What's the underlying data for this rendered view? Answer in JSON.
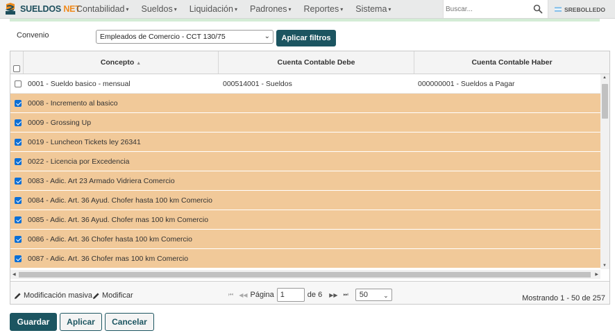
{
  "app": {
    "logo_text_a": "SUELDOS",
    "logo_text_b": "NET"
  },
  "nav": {
    "items": [
      {
        "label": "Contabilidad"
      },
      {
        "label": "Sueldos"
      },
      {
        "label": "Liquidación"
      },
      {
        "label": "Padrones"
      },
      {
        "label": "Reportes"
      },
      {
        "label": "Sistema"
      }
    ],
    "caret": "▾"
  },
  "search": {
    "placeholder": "Buscar...",
    "icon": "search-icon"
  },
  "user": {
    "name": "SREBOLLEDO",
    "flag": "argentina-flag-icon"
  },
  "filter": {
    "label": "Convenio",
    "selected": "Empleados de Comercio - CCT 130/75",
    "apply_label": "Aplicar filtros"
  },
  "grid": {
    "columns": [
      {
        "label": "Concepto",
        "sort": "ascending"
      },
      {
        "label": "Cuenta Contable Debe"
      },
      {
        "label": "Cuenta Contable Haber"
      }
    ],
    "rows": [
      {
        "concepto": "0001 - Sueldo basico - mensual",
        "debe": "000514001 - Sueldos",
        "haber": "000000001 - Sueldos a Pagar",
        "checked": false
      },
      {
        "concepto": "0008 - Incremento al basico",
        "debe": "",
        "haber": "",
        "checked": true
      },
      {
        "concepto": "0009 - Grossing Up",
        "debe": "",
        "haber": "",
        "checked": true
      },
      {
        "concepto": "0019 - Luncheon Tickets ley 26341",
        "debe": "",
        "haber": "",
        "checked": true
      },
      {
        "concepto": "0022 - Licencia por Excedencia",
        "debe": "",
        "haber": "",
        "checked": true
      },
      {
        "concepto": "0083 - Adic. Art 23 Armado Vidriera Comercio",
        "debe": "",
        "haber": "",
        "checked": true
      },
      {
        "concepto": "0084 - Adic. Art. 36 Ayud. Chofer hasta 100 km Comercio",
        "debe": "",
        "haber": "",
        "checked": true
      },
      {
        "concepto": "0085 - Adic. Art. 36 Ayud. Chofer mas 100 km Comercio",
        "debe": "",
        "haber": "",
        "checked": true
      },
      {
        "concepto": "0086 - Adic. Art. 36 Chofer hasta 100 km Comercio",
        "debe": "",
        "haber": "",
        "checked": true
      },
      {
        "concepto": "0087 - Adic. Art. 36 Chofer mas 100 km Comercio",
        "debe": "",
        "haber": "",
        "checked": true
      }
    ],
    "colors": {
      "selected_row": "#f1c999",
      "primary": "#1c5561"
    }
  },
  "footer": {
    "mass_edit_label": "Modificación masiva",
    "edit_label": "Modificar",
    "page_label": "Página",
    "page_value": "1",
    "page_of": "de 6",
    "page_size": "50",
    "showing": "Mostrando 1 - 50 de 257"
  },
  "buttons": {
    "save": "Guardar",
    "apply": "Aplicar",
    "cancel": "Cancelar"
  }
}
